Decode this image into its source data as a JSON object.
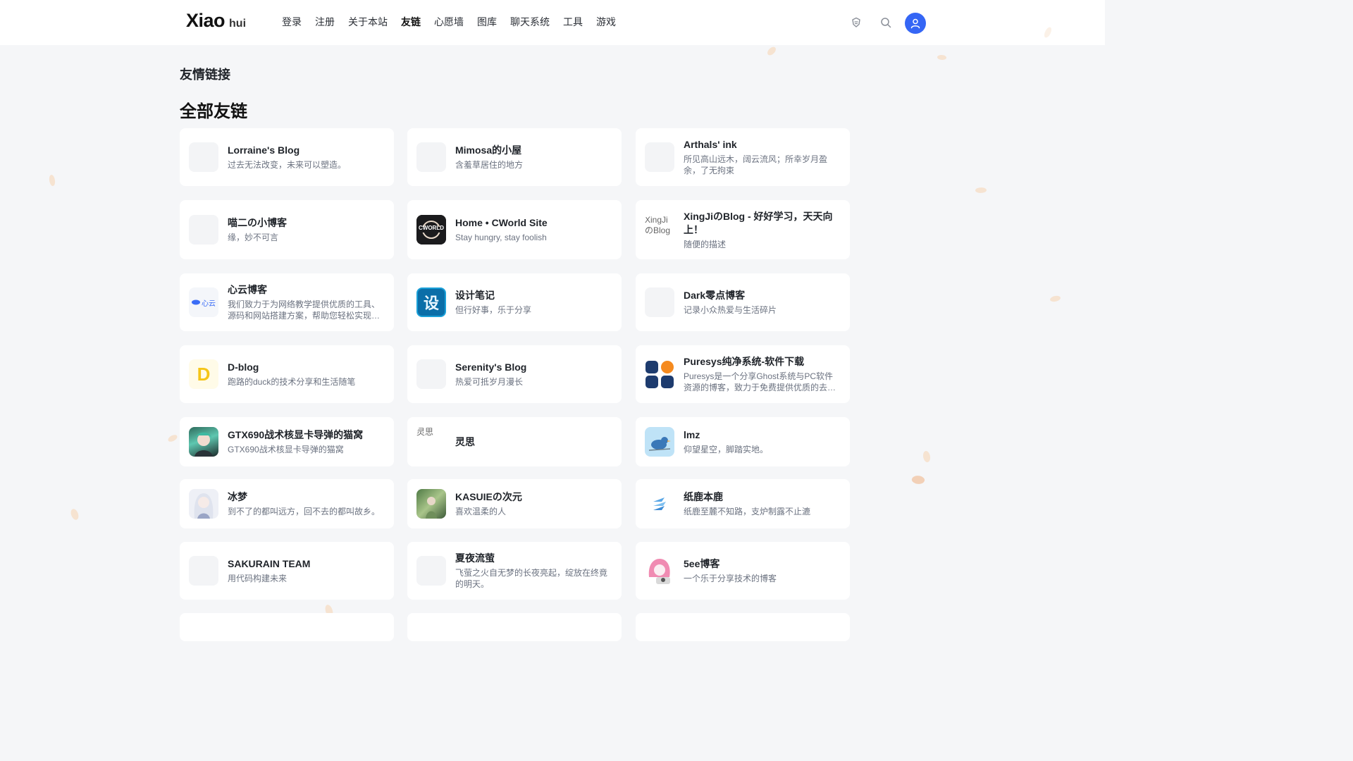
{
  "header": {
    "logo_main": "Xiao",
    "logo_sub": "hui",
    "nav": [
      "登录",
      "注册",
      "关于本站",
      "友链",
      "心愿墙",
      "图库",
      "聊天系统",
      "工具",
      "游戏"
    ],
    "active_nav": "友链",
    "icons": [
      "theme-icon",
      "search-icon",
      "user-icon"
    ]
  },
  "breadcrumb": "友情链接",
  "section_title": "全部友链",
  "links": [
    {
      "title": "Lorraine's Blog",
      "desc": "过去无法改变，未来可以塑造。",
      "thumb": "blank"
    },
    {
      "title": "Mimosa的小屋",
      "desc": "含羞草居住的地方",
      "thumb": "blank"
    },
    {
      "title": "Arthals' ink",
      "desc": "所见高山远木，阔云流风；所幸岁月盈余，了无拘束",
      "thumb": "blank"
    },
    {
      "title": "喵二の小博客",
      "desc": "缘，妙不可言",
      "thumb": "blank"
    },
    {
      "title": "Home • CWorld Site",
      "desc": "Stay hungry, stay foolish",
      "thumb": "cworld",
      "thumb_text": "CWORLD"
    },
    {
      "title": "XingJiのBlog - 好好学习，天天向上！",
      "desc": "随便的描述",
      "thumb": "alt",
      "thumb_text": "XingJiのBlog"
    },
    {
      "title": "心云博客",
      "desc": "我们致力于为网络教学提供优质的工具、源码和网站搭建方案，帮助您轻松实现教学目标。",
      "thumb": "xinyun",
      "thumb_text": "心云"
    },
    {
      "title": "设计笔记",
      "desc": "但行好事，乐于分享",
      "thumb": "design",
      "thumb_text": "设"
    },
    {
      "title": "Dark零点博客",
      "desc": "记录小众热爱与生活碎片",
      "thumb": "blank"
    },
    {
      "title": "D-blog",
      "desc": "跑路的duck的技术分享和生活随笔",
      "thumb": "dblog",
      "thumb_text": "D"
    },
    {
      "title": "Serenity's Blog",
      "desc": "热爱可抵岁月漫长",
      "thumb": "blank"
    },
    {
      "title": "Puresys纯净系统-软件下载",
      "desc": "Puresys是一个分享Ghost系统与PC软件资源的博客，致力于免费提供优质的去广告软件。",
      "thumb": "puresys"
    },
    {
      "title": "GTX690战术核显卡导弹的猫窝",
      "desc": "GTX690战术核显卡导弹的猫窝",
      "thumb": "anime-green"
    },
    {
      "title": "灵思",
      "desc": "",
      "thumb": "alt",
      "thumb_text": "灵思"
    },
    {
      "title": "lmz",
      "desc": "仰望星空，脚踏实地。",
      "thumb": "bird"
    },
    {
      "title": "冰梦",
      "desc": "到不了的都叫远方，回不去的都叫故乡。",
      "thumb": "anime-white"
    },
    {
      "title": "KASUIEの次元",
      "desc": "喜欢温柔的人",
      "thumb": "forest"
    },
    {
      "title": "纸鹿本鹿",
      "desc": "纸鹿至麓不知路，支炉制露不止漉",
      "thumb": "paper"
    },
    {
      "title": "SAKURAIN TEAM",
      "desc": "用代码构建未来",
      "thumb": "blank"
    },
    {
      "title": "夏夜流萤",
      "desc": "飞萤之火自无梦的长夜亮起，绽放在终竟的明天。",
      "thumb": "blank"
    },
    {
      "title": "5ee博客",
      "desc": "一个乐于分享技术的博客",
      "thumb": "pink"
    }
  ],
  "colors": {
    "accent": "#3566f5",
    "background": "#f5f6f8",
    "card": "#ffffff"
  }
}
